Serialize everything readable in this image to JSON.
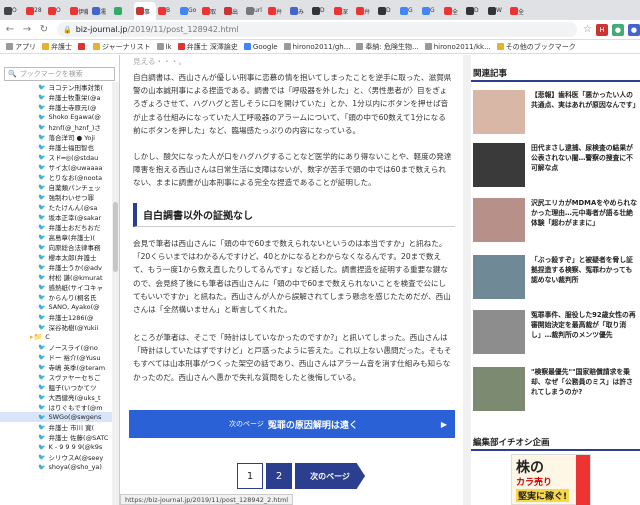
{
  "tabs": [
    {
      "label": "O",
      "color": "#444"
    },
    {
      "label": "28",
      "color": "#e33"
    },
    {
      "label": "O",
      "color": "#e33"
    },
    {
      "label": "伊藤",
      "color": "#e33"
    },
    {
      "label": "濡",
      "color": "#46c"
    },
    {
      "label": "",
      "color": "#3a6"
    },
    {
      "label": "事",
      "color": "#c33"
    },
    {
      "label": "B",
      "color": "#e33"
    },
    {
      "label": "Go",
      "color": "#4285f4"
    },
    {
      "label": "取",
      "color": "#e33"
    },
    {
      "label": "出",
      "color": "#c33"
    },
    {
      "label": "url",
      "color": "#777"
    },
    {
      "label": "弁",
      "color": "#e33"
    },
    {
      "label": "み",
      "color": "#46c"
    },
    {
      "label": "D",
      "color": "#333"
    },
    {
      "label": "深",
      "color": "#e33"
    },
    {
      "label": "弁",
      "color": "#e33"
    },
    {
      "label": "D",
      "color": "#333"
    },
    {
      "label": "G",
      "color": "#4285f4"
    },
    {
      "label": "G",
      "color": "#4285f4"
    },
    {
      "label": "全",
      "color": "#e33"
    },
    {
      "label": "D",
      "color": "#333"
    },
    {
      "label": "W",
      "color": "#333"
    },
    {
      "label": "全",
      "color": "#e33"
    }
  ],
  "address": {
    "host": "biz-journal.jp",
    "path": "/2019/11/post_128942.html"
  },
  "bookmarks": [
    {
      "label": "アプリ",
      "icon": "apps-icon",
      "cls": ""
    },
    {
      "label": "弁護士",
      "icon": "folder-icon",
      "cls": "y"
    },
    {
      "label": "",
      "icon": "bookmark-icon",
      "cls": "r"
    },
    {
      "label": "ジャーナリスト",
      "icon": "folder-icon",
      "cls": "y"
    },
    {
      "label": "lk",
      "icon": "bookmark-icon",
      "cls": ""
    },
    {
      "label": "弁護士 深澤論史",
      "icon": "bookmark-icon",
      "cls": "r"
    },
    {
      "label": "Google",
      "icon": "google-icon",
      "cls": "g"
    },
    {
      "label": "hirono2011/gh...",
      "icon": "github-icon",
      "cls": ""
    },
    {
      "label": "奉納: 危険生物...",
      "icon": "bookmark-icon",
      "cls": ""
    },
    {
      "label": "hirono2011/kk...",
      "icon": "github-icon",
      "cls": ""
    },
    {
      "label": "その他のブックマーク",
      "icon": "folder-icon",
      "cls": "y"
    }
  ],
  "sidebar": {
    "search_placeholder": "ブックマークを検索",
    "items": [
      {
        "label": "ヨコテン刑事対策(",
        "type": "bird"
      },
      {
        "label": "弁護士牧重栄(@a",
        "type": "bird"
      },
      {
        "label": "弁護士寺原元(@",
        "type": "bird"
      },
      {
        "label": "Shoko Egawa(@",
        "type": "bird"
      },
      {
        "label": "hznf(@_hznf_)さ",
        "type": "bird"
      },
      {
        "label": "落合洋司 ● Yoji",
        "type": "bird"
      },
      {
        "label": "弁護士福田智也",
        "type": "bird"
      },
      {
        "label": "スド━◎(@stdau",
        "type": "bird"
      },
      {
        "label": "サイ太(@uwaaaa",
        "type": "bird"
      },
      {
        "label": "とりなお(@noota",
        "type": "bird"
      },
      {
        "label": "自薬類パンチェッ",
        "type": "bird"
      },
      {
        "label": "強制わいせつ罪",
        "type": "bird"
      },
      {
        "label": "たたけんん(@sa",
        "type": "bird"
      },
      {
        "label": "坂本正幸(@sakar",
        "type": "bird"
      },
      {
        "label": "弁護士おだちおだ",
        "type": "bird"
      },
      {
        "label": "高島章(弁護士)(",
        "type": "bird"
      },
      {
        "label": "向原総合法律事務",
        "type": "bird"
      },
      {
        "label": "櫻本太郎(弁護士",
        "type": "bird"
      },
      {
        "label": "弁護士うか(@adv",
        "type": "bird"
      },
      {
        "label": "村松 謙(@kmurat",
        "type": "bird"
      },
      {
        "label": "感熱紙(サイコキャ",
        "type": "bird"
      },
      {
        "label": "からんり(桐名氏",
        "type": "bird"
      },
      {
        "label": "SANO, Ayako(@",
        "type": "bird"
      },
      {
        "label": "弁護士1286(@",
        "type": "bird"
      },
      {
        "label": "深谷祐樹(@Yukii",
        "type": "bird"
      },
      {
        "label": "C",
        "type": "folder"
      },
      {
        "label": "ノースライ(@no",
        "type": "bird"
      },
      {
        "label": "ドー 裕介(@Yusu",
        "type": "bird"
      },
      {
        "label": "寺嶋 英季(@teram",
        "type": "bird"
      },
      {
        "label": "スヴァヤーセちご",
        "type": "bird"
      },
      {
        "label": "饂子(いつかてツ",
        "type": "bird"
      },
      {
        "label": "大西健亮(@uks_t",
        "type": "bird"
      },
      {
        "label": "はりぐもです(@m",
        "type": "bird"
      },
      {
        "label": "SWGo(@swgens",
        "type": "bird",
        "selected": true
      },
      {
        "label": "弁護士 市川 寛(",
        "type": "bird"
      },
      {
        "label": "弁護士 佐藤(@SATC",
        "type": "bird"
      },
      {
        "label": "K - 9 9 9 9(@k9s",
        "type": "bird"
      },
      {
        "label": "シリウスA(@seey",
        "type": "bird"
      },
      {
        "label": "shoya(@sho_ya)",
        "type": "bird"
      }
    ]
  },
  "article": {
    "para1": "見える・・・。",
    "para2": "自白調書は、西山さんが優しい刑事に恋慕の情を抱いてしまったことを逆手に取った、滋賀県警の山本誠刑事による捏造である。調書では「呼吸器を外した」と、〈男性患者が〉目をぎょろぎょろさせて、ハグハグと苦しそうに口を開けていた」とか、1分以内にボタンを押せば音が止まる仕組みになっていた人工呼吸器のアラームについて、「頭の中で60数えて1分になる前にボタンを押した」など、臨場感たっぷりの内容になっている。",
    "para3": "しかし、酸欠になった人が口をハグハグすることなど医学的にあり得ないことや、軽度の発達障害を抱える西山さんは日常生活に支障はないが、数字が苦手で頭の中では60まで数えられない、ままに調書が山本刑事による完全な捏造であることが証明した。",
    "heading": "自白調書以外の証拠なし",
    "para4": "会見で筆者は西山さんに「頭の中で60まで数えられないというのは本当ですか」と訊ねた。「20くらいまではわかるんですけど、40とかになるとわからなくなるんです。20まで数えて、もう一度1から数え直したりしてるんです」など話した。調書捏造を証明する重要な鍵なので、会見終了後にも筆者は西山さんに「頭の中で60まで数えられないことを検査で公にしてもいいですか」と訊ねた。西山さんが人から誤解されてしまう懸念を感じたためだが、西山さんは「全然構いません」と断言してくれた。",
    "para5": "ところが筆者は、そこで「時計はしていなかったのですか?」と訊いてしまった。西山さんは「時計はしていたはずですけど」と戸惑ったように答えた。これ以上ない愚問だった。そもそもすべては山本刑事がつくった架空の話であり、西山さんはアラーム音を消す仕組みも知らなかったのだ。西山さんへ愚かで失礼な質問をしたと後悔している。",
    "next_label": "次のページ",
    "next_title": "冤罪の原因解明は遠く",
    "pager_current": "1",
    "pager_page2": "2",
    "pager_next": "次のページ"
  },
  "rail": {
    "heading": "関連記事",
    "items": [
      {
        "text": "【悲報】歯科医「悪かったい人の共通点、実はあれが原因なんです」",
        "thumb": "#d8b7a6"
      },
      {
        "text": "田代まさし逮捕、尿検査の結果が公表されない闇…警察の捜査に不可解な点",
        "thumb": "#3a3a3a"
      },
      {
        "text": "沢尻エリカがMDMAをやめられなかった理由…元中毒者が語る壮絶体験「超わがままに」",
        "thumb": "#b8908a"
      },
      {
        "text": "「ぶっ殺すぞ」と被疑者を脅し証拠捏造する検察、冤罪わかっても認めない裁判所",
        "thumb": "#6f8a96"
      },
      {
        "text": "冤罪事件、服役した92歳女性の再審開始決定を最高裁が「取り消し」…裁判所のメンツ優先",
        "thumb": "#8d8d8d"
      },
      {
        "text": "\"検察最優先\"\"国家賠償請求を乗却、なぜ「公務員のミス」は許されてしまうのか?",
        "thumb": "#7b8a70"
      }
    ],
    "heading2": "編集部イチオシ企画",
    "book_title": "株の",
    "book_sub": "カラ売り",
    "book_tag": "堅実に稼ぐ!"
  },
  "status_url": "https://biz-journal.jp/2019/11/post_128942_2.html"
}
